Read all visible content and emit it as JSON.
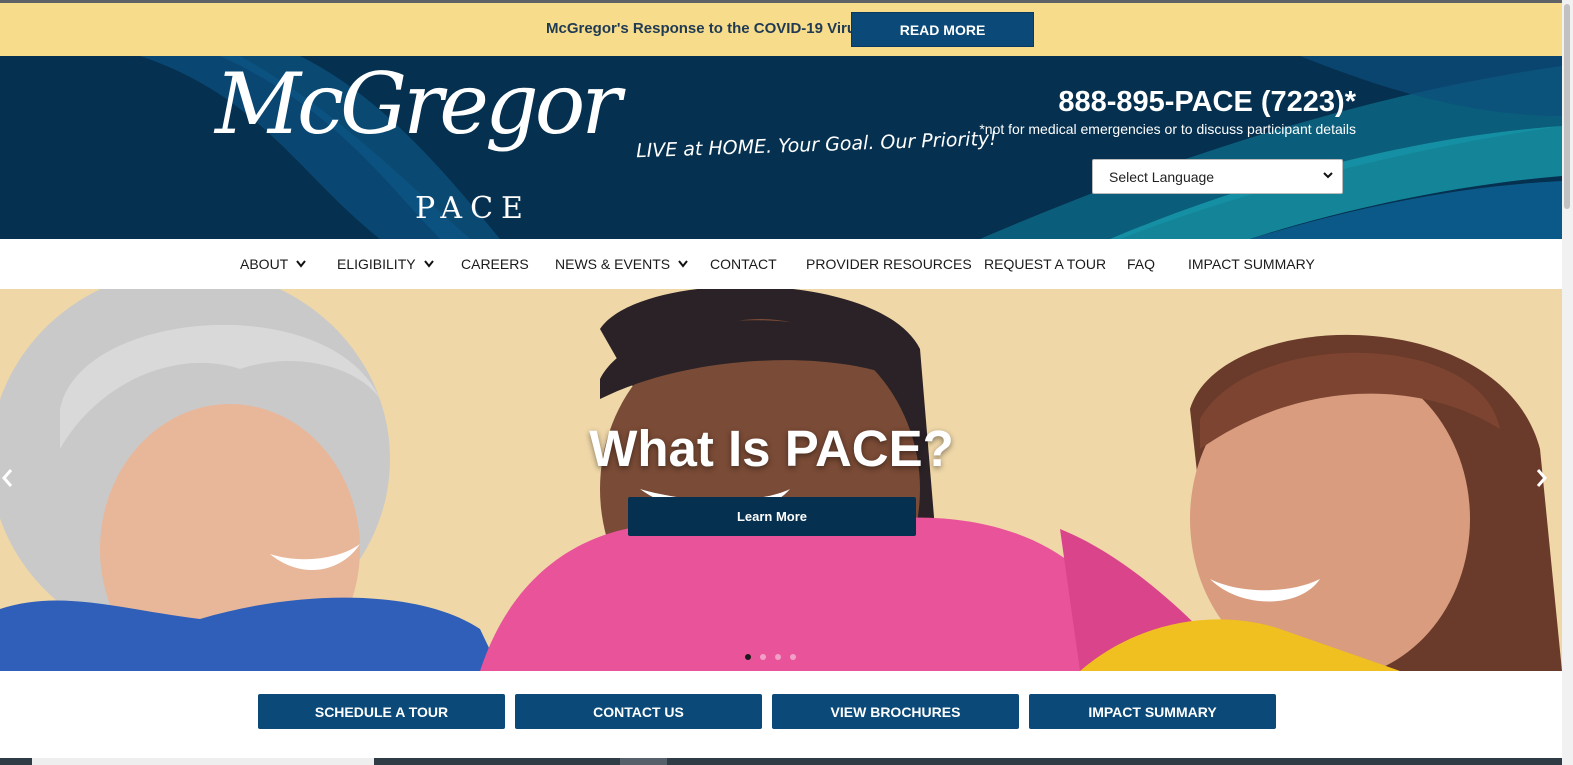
{
  "announcement": {
    "text": "McGregor's Response to the COVID-19 Virus",
    "button_label": "READ MORE"
  },
  "header": {
    "logo_script": "McGregor",
    "logo_sub": "PACE",
    "tagline": "LIVE at HOME. Your Goal. Our Priority!",
    "phone": "888-895-PACE (7223)*",
    "phone_note": "*not for medical emergencies or to discuss participant details",
    "language_select": "Select Language"
  },
  "nav": {
    "items": [
      {
        "label": "ABOUT",
        "dropdown": true
      },
      {
        "label": "ELIGIBILITY",
        "dropdown": true
      },
      {
        "label": "CAREERS",
        "dropdown": false
      },
      {
        "label": "NEWS & EVENTS",
        "dropdown": true
      },
      {
        "label": "CONTACT",
        "dropdown": false
      },
      {
        "label": "PROVIDER RESOURCES",
        "dropdown": false
      },
      {
        "label": "REQUEST A TOUR",
        "dropdown": false
      },
      {
        "label": "FAQ",
        "dropdown": false
      },
      {
        "label": "IMPACT SUMMARY",
        "dropdown": false
      }
    ]
  },
  "hero": {
    "title": "What Is PACE?",
    "button_label": "Learn More",
    "slide_count": 4,
    "active_slide": 1
  },
  "cta": {
    "buttons": [
      "SCHEDULE A TOUR",
      "CONTACT US",
      "VIEW BROCHURES",
      "IMPACT SUMMARY"
    ]
  },
  "colors": {
    "banner": "#f7dc8c",
    "navy": "#05304f",
    "button_blue": "#0b4a78"
  }
}
